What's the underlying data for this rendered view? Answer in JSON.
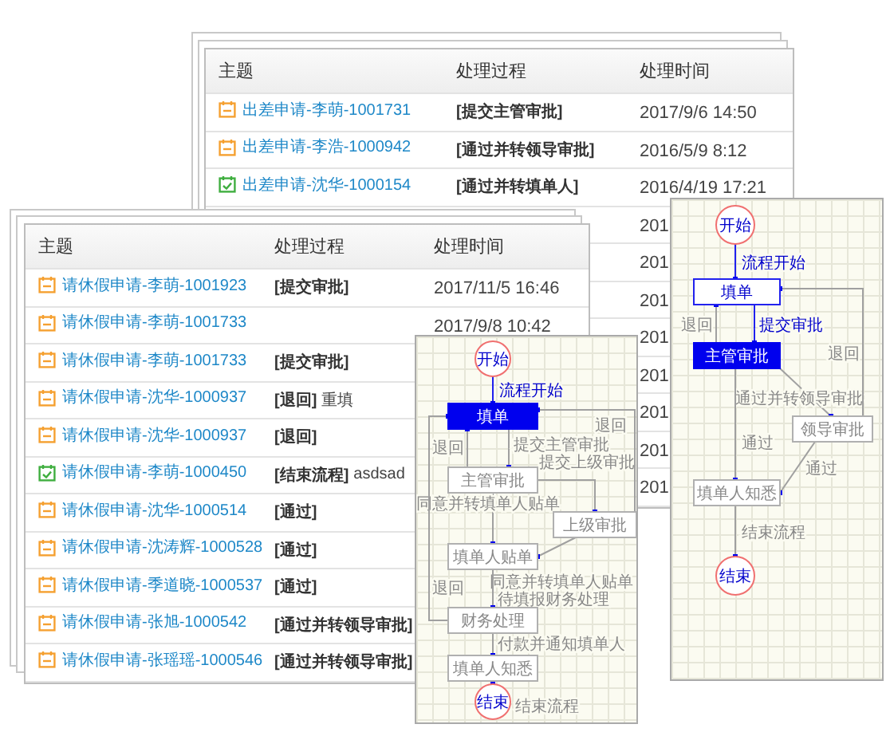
{
  "top_table": {
    "columns": [
      "主题",
      "处理过程",
      "处理时间"
    ],
    "rows": [
      {
        "subject": "出差申请-李萌-1001731",
        "action": "[提交主管审批]",
        "time": "2017/9/6 14:50",
        "done": false
      },
      {
        "subject": "出差申请-李浩-1000942",
        "action": "[通过并转领导审批]",
        "time": "2016/5/9 8:12",
        "done": false
      },
      {
        "subject": "出差申请-沈华-1000154",
        "action": "[通过并转填单人]",
        "time": "2016/4/19 17:21",
        "done": true
      },
      {
        "time": "201"
      },
      {
        "time": "201"
      },
      {
        "time": "201"
      },
      {
        "time": "201"
      },
      {
        "time": "201"
      },
      {
        "time": "201"
      },
      {
        "time": "201"
      },
      {
        "time": "201"
      }
    ]
  },
  "bottom_table": {
    "columns": [
      "主题",
      "处理过程",
      "处理时间"
    ],
    "rows": [
      {
        "subject": "请休假申请-李萌-1001923",
        "action": "[提交审批]",
        "time": "2017/11/5 16:46",
        "done": false
      },
      {
        "subject": "请休假申请-李萌-1001733",
        "time": "2017/9/8 10:42",
        "done": false
      },
      {
        "subject": "请休假申请-李萌-1001733",
        "action": "[提交审批]",
        "done": false
      },
      {
        "subject": "请休假申请-沈华-1000937",
        "action": "[退回]",
        "note": "重填",
        "done": false
      },
      {
        "subject": "请休假申请-沈华-1000937",
        "action": "[退回]",
        "done": false
      },
      {
        "subject": "请休假申请-李萌-1000450",
        "action": "[结束流程]",
        "note": "asdsad",
        "done": true
      },
      {
        "subject": "请休假申请-沈华-1000514",
        "action": "[通过]",
        "done": false
      },
      {
        "subject": "请休假申请-沈涛辉-1000528",
        "action": "[通过]",
        "done": false
      },
      {
        "subject": "请休假申请-季道晓-1000537",
        "action": "[通过]",
        "done": false
      },
      {
        "subject": "请休假申请-张旭-1000542",
        "action": "[通过并转领导审批]",
        "done": false
      },
      {
        "subject": "请休假申请-张瑶瑶-1000546",
        "action": "[通过并转领导审批]",
        "done": false
      }
    ]
  },
  "flowchart_middle": {
    "nodes": [
      {
        "label": "开始",
        "kind": "start"
      },
      {
        "label": "填单",
        "kind": "task",
        "active": true,
        "visited": false
      },
      {
        "label": "主管审批",
        "kind": "task",
        "active": false,
        "visited": false
      },
      {
        "label": "上级审批",
        "kind": "task",
        "active": false,
        "visited": false
      },
      {
        "label": "填单人贴单",
        "kind": "task",
        "active": false,
        "visited": false
      },
      {
        "label": "财务处理",
        "kind": "task",
        "active": false,
        "visited": false
      },
      {
        "label": "填单人知悉",
        "kind": "task",
        "active": false,
        "visited": false
      },
      {
        "label": "结束",
        "kind": "end"
      }
    ],
    "edges": [
      {
        "label": "流程开始",
        "taken": true
      },
      {
        "label": "退回",
        "taken": false
      },
      {
        "label": "提交主管审批",
        "taken": false
      },
      {
        "label": "提交上级审批",
        "taken": false
      },
      {
        "label": "同意并转填单人贴单",
        "taken": false
      },
      {
        "label": "同意并转填单人贴单",
        "taken": false
      },
      {
        "label": "退回",
        "taken": false
      },
      {
        "label": "退回",
        "taken": false
      },
      {
        "label": "待填报财务处理",
        "taken": false
      },
      {
        "label": "付款并通知填单人",
        "taken": false
      },
      {
        "label": "结束流程",
        "taken": false
      }
    ]
  },
  "flowchart_right": {
    "nodes": [
      {
        "label": "开始",
        "kind": "start"
      },
      {
        "label": "填单",
        "kind": "task",
        "active": false,
        "visited": true
      },
      {
        "label": "主管审批",
        "kind": "task",
        "active": true,
        "visited": false
      },
      {
        "label": "领导审批",
        "kind": "task",
        "active": false,
        "visited": false
      },
      {
        "label": "填单人知悉",
        "kind": "task",
        "active": false,
        "visited": false
      },
      {
        "label": "结束",
        "kind": "end"
      }
    ],
    "edges": [
      {
        "label": "流程开始",
        "taken": true
      },
      {
        "label": "退回",
        "taken": false
      },
      {
        "label": "提交审批",
        "taken": true
      },
      {
        "label": "通过并转领导审批",
        "taken": false
      },
      {
        "label": "通过",
        "taken": false
      },
      {
        "label": "退回",
        "taken": false
      },
      {
        "label": "通过",
        "taken": false
      },
      {
        "label": "结束流程",
        "taken": false
      }
    ]
  }
}
